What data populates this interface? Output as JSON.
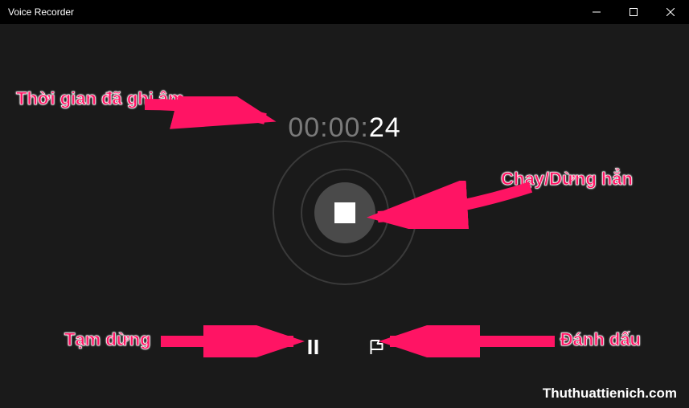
{
  "window": {
    "title": "Voice Recorder"
  },
  "timer": {
    "dim_part": "00:00:",
    "bright_part": "24"
  },
  "annotations": {
    "time_label": "Thời gian đã ghi âm",
    "stop_label": "Chạy/Dừng hẳn",
    "pause_label": "Tạm dừng",
    "flag_label": "Đánh dấu"
  },
  "watermark": "Thuthuattienich.com",
  "accent_color": "#ff1464"
}
